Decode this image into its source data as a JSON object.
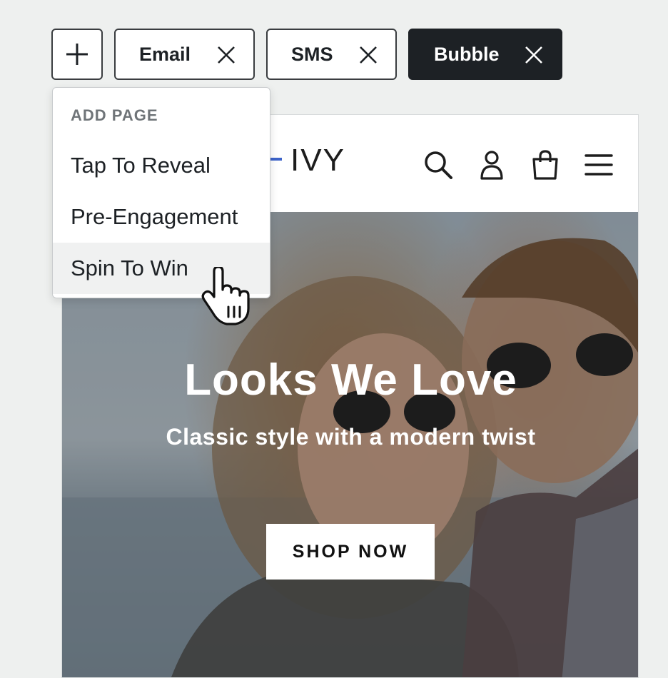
{
  "tabs": {
    "add_icon": "plus-icon",
    "items": [
      {
        "label": "Email",
        "active": false,
        "close_icon": "close-icon"
      },
      {
        "label": "SMS",
        "active": false,
        "close_icon": "close-icon"
      },
      {
        "label": "Bubble",
        "active": true,
        "close_icon": "close-icon"
      }
    ]
  },
  "dropdown": {
    "header": "ADD PAGE",
    "items": [
      {
        "label": "Tap To Reveal"
      },
      {
        "label": "Pre-Engagement"
      },
      {
        "label": "Spin To Win",
        "hovered": true
      }
    ]
  },
  "preview": {
    "logo": "IVY",
    "icons": [
      "search-icon",
      "account-icon",
      "cart-icon",
      "menu-icon"
    ],
    "hero": {
      "title": "Looks We Love",
      "subtitle": "Classic style with a modern twist",
      "button": "SHOP NOW"
    }
  },
  "colors": {
    "active_tab_bg": "#1d2125",
    "logo_accent": "#3d63c9",
    "page_bg": "#eef0ef"
  }
}
